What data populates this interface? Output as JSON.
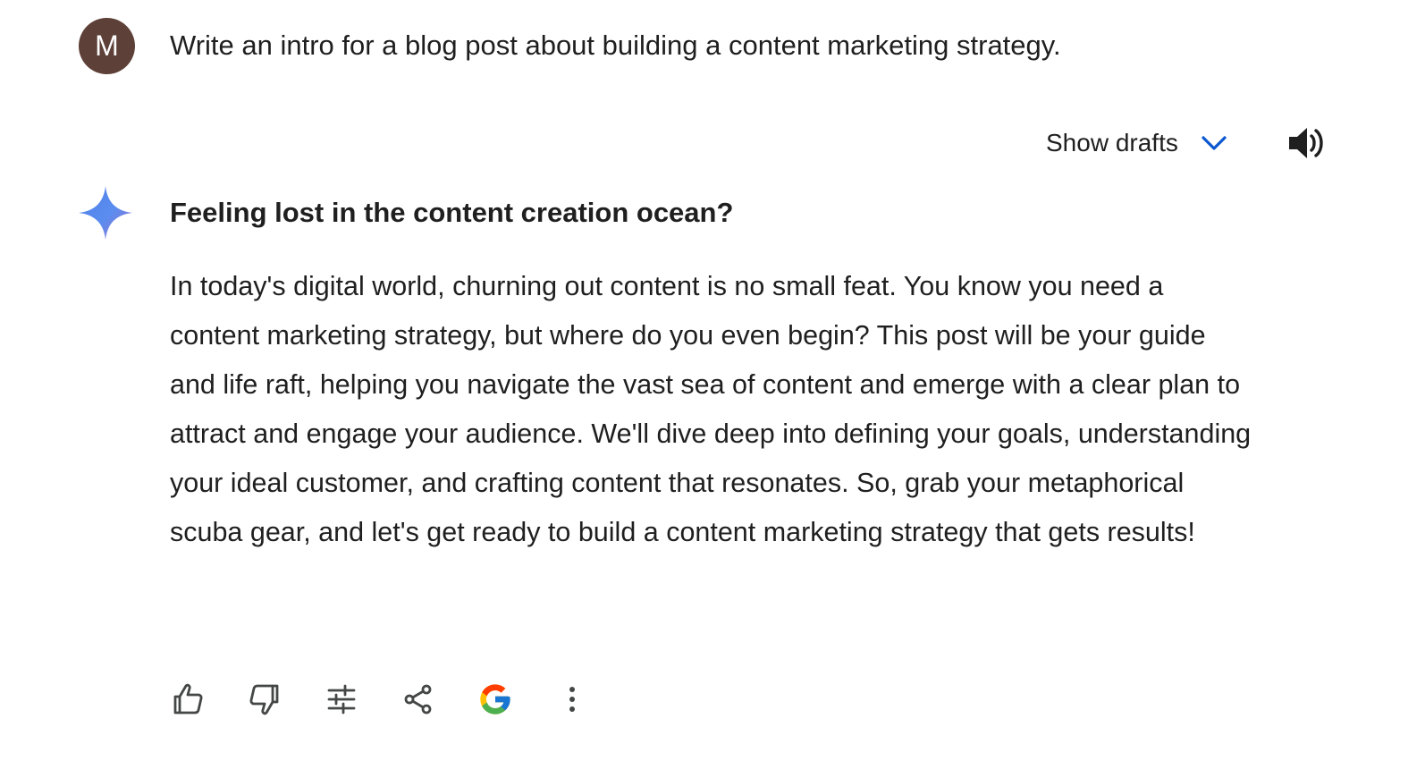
{
  "user": {
    "avatar_initial": "M",
    "avatar_color": "#5d4037",
    "prompt": "Write an intro for a blog post about building a content marketing strategy."
  },
  "drafts": {
    "label": "Show drafts",
    "chevron_color": "#0b57d0"
  },
  "response": {
    "title": "Feeling lost in the content creation ocean?",
    "body": "In today's digital world, churning out content is no small feat. You know you need a content marketing strategy, but where do you even begin?  This post will be your guide and life raft, helping you navigate the vast sea of content and emerge with a clear plan to attract and engage your audience.  We'll dive deep into defining your goals, understanding your ideal customer, and crafting content that resonates. So, grab your metaphorical scuba gear, and let's get ready to build a content marketing strategy that gets results!"
  },
  "actions": [
    {
      "icon": "thumbs-up-icon"
    },
    {
      "icon": "thumbs-down-icon"
    },
    {
      "icon": "tune-icon"
    },
    {
      "icon": "share-icon"
    },
    {
      "icon": "google-g-icon"
    },
    {
      "icon": "more-vert-icon"
    }
  ],
  "colors": {
    "text": "#1f1f1f",
    "icon": "#444746",
    "spark_start": "#4f7fe8",
    "spark_end": "#8a6ad6"
  }
}
